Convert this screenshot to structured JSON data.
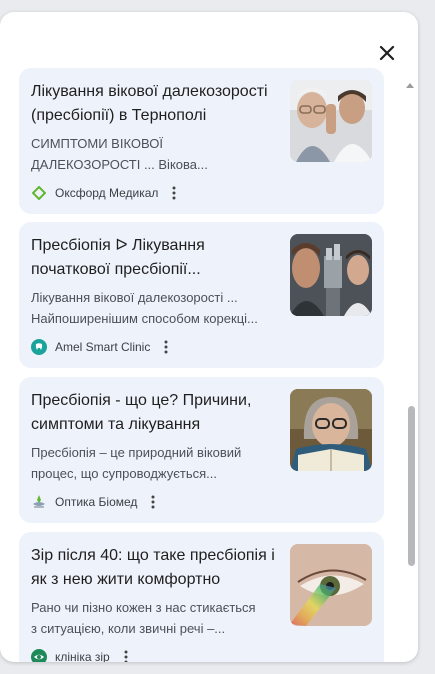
{
  "panel": {
    "close_icon": "close-icon"
  },
  "results": [
    {
      "title_lines": [
        "Лікування вікової далекозорості",
        "(пресбіопії) в Тернополі"
      ],
      "snippet_lines": [
        "СИМПТОМИ ВІКОВОЇ",
        "ДАЛЕКОЗОРОСТІ ... Вікова..."
      ],
      "source": "Оксфорд Медикал",
      "favicon": "diamond-icon"
    },
    {
      "title_lines": [
        "Пресбіопія ᐅ Лікування",
        "початкової пресбіопії..."
      ],
      "snippet_lines": [
        "Лікування вікової далекозорості ...",
        "Найпоширенішим способом корекці..."
      ],
      "source": "Amel Smart Clinic",
      "favicon": "tooth-icon"
    },
    {
      "title_lines": [
        "Пресбіопія - що це? Причини,",
        "симптоми та лікування"
      ],
      "snippet_lines": [
        "Пресбіопія – це природний віковий",
        "процес, що супроводжується..."
      ],
      "source": "Оптика Біомед",
      "favicon": "optics-icon"
    },
    {
      "title_lines": [
        "Зір після 40: що таке пресбіопія і",
        "як з нею жити комфортно"
      ],
      "snippet_lines": [
        "Рано чи пізно кожен з нас стикається",
        "з ситуацією, коли звичні речі –..."
      ],
      "source": "клініка зір",
      "favicon": "eye-logo-icon"
    }
  ],
  "colors": {
    "card_background": "#eef2fb",
    "title": "#1f1f1f",
    "snippet": "#4d5156",
    "favicon_green": "#63b72f",
    "favicon_teal": "#1aa39a"
  }
}
